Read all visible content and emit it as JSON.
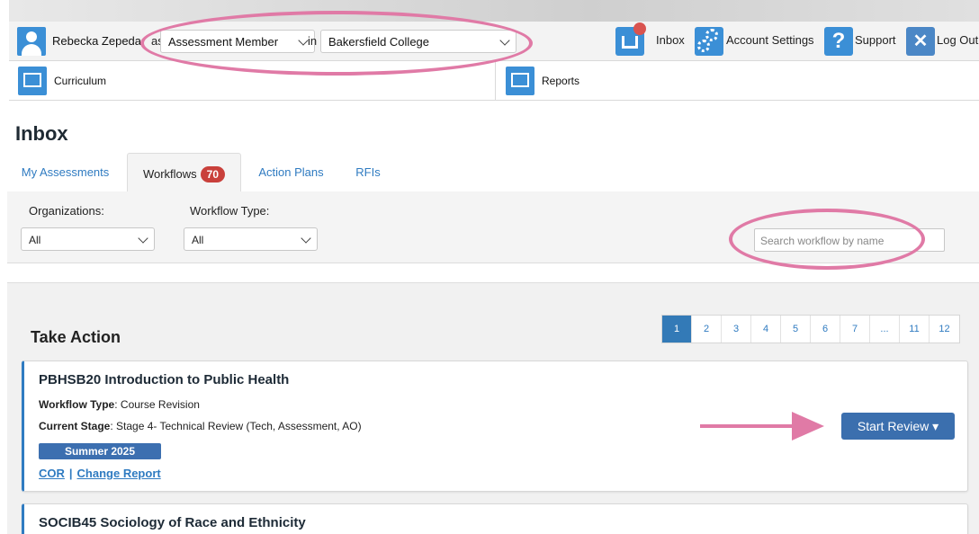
{
  "header": {
    "user_name": "Rebecka Zepeda",
    "as_text": "as",
    "role_value": "Assessment Member",
    "in_text": "in",
    "college_value": "Bakersfield College",
    "inbox_label": "Inbox",
    "account_label": "Account Settings",
    "support_label": "Support",
    "logout_label": "Log Out"
  },
  "nav": {
    "curriculum_label": "Curriculum",
    "reports_label": "Reports"
  },
  "page": {
    "title": "Inbox"
  },
  "tabs": [
    {
      "label": "My Assessments"
    },
    {
      "label": "Workflows",
      "badge": "70"
    },
    {
      "label": "Action Plans"
    },
    {
      "label": "RFIs"
    }
  ],
  "filters": {
    "org_label": "Organizations:",
    "org_value": "All",
    "type_label": "Workflow Type:",
    "type_value": "All",
    "search_placeholder": "Search workflow by name"
  },
  "take_action": {
    "title": "Take Action",
    "pages": [
      "1",
      "2",
      "3",
      "4",
      "5",
      "6",
      "7",
      "...",
      "11",
      "12"
    ],
    "current_page": "1"
  },
  "cards": [
    {
      "title": "PBHSB20 Introduction to Public Health",
      "type_label": "Workflow Type",
      "type_value": ": Course Revision",
      "stage_label": "Current Stage",
      "stage_value": ": Stage 4- Technical Review (Tech, Assessment, AO)",
      "term": "Summer 2025",
      "link1": "COR",
      "link2": "Change Report",
      "button": "Start Review ▾"
    },
    {
      "title": "SOCIB45 Sociology of Race and Ethnicity"
    }
  ],
  "colors": {
    "accent": "#337ab7",
    "badge": "#c9403b",
    "annotation": "#e07aa6"
  }
}
